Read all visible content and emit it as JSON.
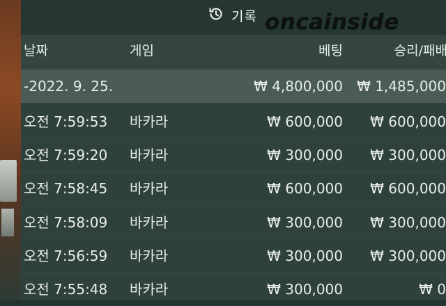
{
  "header": {
    "title": "기록",
    "watermark": "oncainside"
  },
  "table": {
    "columns": {
      "date": "날짜",
      "game": "게임",
      "bet": "베팅",
      "win_loss": "승리/패배"
    },
    "summary": {
      "date": "-2022. 9. 25.",
      "bet": "₩ 4,800,000",
      "win_loss": "₩ 1,485,000"
    },
    "rows": [
      {
        "time": "오전 7:59:53",
        "game": "바카라",
        "bet": "₩ 600,000",
        "win_loss": "₩ 600,000"
      },
      {
        "time": "오전 7:59:20",
        "game": "바카라",
        "bet": "₩ 300,000",
        "win_loss": "₩ 300,000"
      },
      {
        "time": "오전 7:58:45",
        "game": "바카라",
        "bet": "₩ 600,000",
        "win_loss": "₩ 600,000"
      },
      {
        "time": "오전 7:58:09",
        "game": "바카라",
        "bet": "₩ 300,000",
        "win_loss": "₩ 300,000"
      },
      {
        "time": "오전 7:56:59",
        "game": "바카라",
        "bet": "₩ 300,000",
        "win_loss": "₩ 300,000"
      },
      {
        "time": "오전 7:55:48",
        "game": "바카라",
        "bet": "₩ 300,000",
        "win_loss": "₩ 0"
      }
    ]
  }
}
